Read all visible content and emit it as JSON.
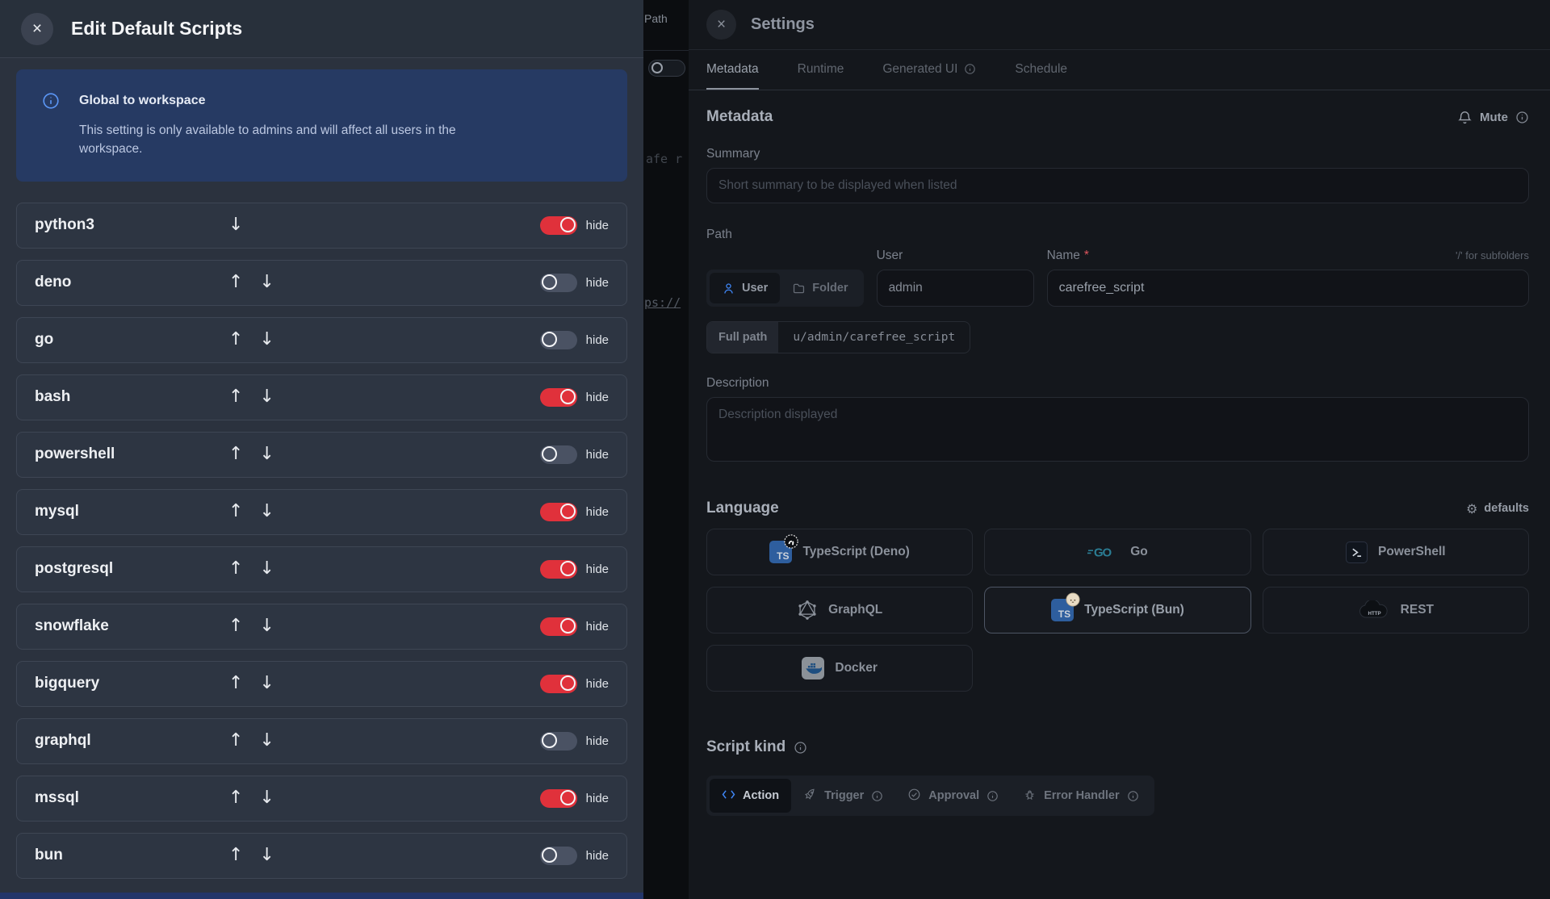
{
  "left_drawer": {
    "title": "Edit Default Scripts",
    "info": {
      "title": "Global to workspace",
      "body": "This setting is only available to admins and will affect all users in the workspace."
    },
    "hide_label": "hide",
    "items": [
      {
        "name": "python3",
        "up": false,
        "down": true,
        "hidden": true
      },
      {
        "name": "deno",
        "up": true,
        "down": true,
        "hidden": false
      },
      {
        "name": "go",
        "up": true,
        "down": true,
        "hidden": false
      },
      {
        "name": "bash",
        "up": true,
        "down": true,
        "hidden": true
      },
      {
        "name": "powershell",
        "up": true,
        "down": true,
        "hidden": false
      },
      {
        "name": "mysql",
        "up": true,
        "down": true,
        "hidden": true
      },
      {
        "name": "postgresql",
        "up": true,
        "down": true,
        "hidden": true
      },
      {
        "name": "snowflake",
        "up": true,
        "down": true,
        "hidden": true
      },
      {
        "name": "bigquery",
        "up": true,
        "down": true,
        "hidden": true
      },
      {
        "name": "graphql",
        "up": true,
        "down": true,
        "hidden": false
      },
      {
        "name": "mssql",
        "up": true,
        "down": true,
        "hidden": true
      },
      {
        "name": "bun",
        "up": true,
        "down": true,
        "hidden": false
      }
    ]
  },
  "background": {
    "path_label": "Path",
    "code_fragment_1": "afe r",
    "code_fragment_2": "ps://"
  },
  "right_drawer": {
    "title": "Settings",
    "tabs": [
      {
        "label": "Metadata",
        "active": true,
        "info": false
      },
      {
        "label": "Runtime",
        "active": false,
        "info": false
      },
      {
        "label": "Generated UI",
        "active": false,
        "info": true
      },
      {
        "label": "Schedule",
        "active": false,
        "info": false
      }
    ],
    "metadata": {
      "heading": "Metadata",
      "mute_label": "Mute",
      "summary_label": "Summary",
      "summary_placeholder": "Short summary to be displayed when listed",
      "path_label": "Path",
      "owner_user_label": "User",
      "owner_folder_label": "Folder",
      "user_label": "User",
      "user_value": "admin",
      "name_label": "Name",
      "name_required_mark": "*",
      "name_hint": "'/' for subfolders",
      "name_value": "carefree_script",
      "full_path_label": "Full path",
      "full_path_value": "u/admin/carefree_script",
      "description_label": "Description",
      "description_placeholder": "Description displayed"
    },
    "language": {
      "heading": "Language",
      "defaults_label": "defaults",
      "options": [
        {
          "label": "TypeScript (Deno)",
          "icon": "ts-deno",
          "selected": false
        },
        {
          "label": "Go",
          "icon": "go",
          "selected": false
        },
        {
          "label": "PowerShell",
          "icon": "pwsh",
          "selected": false
        },
        {
          "label": "GraphQL",
          "icon": "graphql",
          "selected": false
        },
        {
          "label": "TypeScript (Bun)",
          "icon": "ts-bun",
          "selected": true
        },
        {
          "label": "REST",
          "icon": "rest",
          "selected": false
        },
        {
          "label": "Docker",
          "icon": "docker",
          "selected": false
        }
      ]
    },
    "script_kind": {
      "heading": "Script kind",
      "options": [
        {
          "label": "Action",
          "icon": "code",
          "active": true,
          "info": false
        },
        {
          "label": "Trigger",
          "icon": "rocket",
          "active": false,
          "info": true
        },
        {
          "label": "Approval",
          "icon": "check",
          "active": false,
          "info": true
        },
        {
          "label": "Error Handler",
          "icon": "bug",
          "active": false,
          "info": true
        }
      ]
    }
  },
  "icons": {
    "close": "×",
    "up_arrow": "↑",
    "down_arrow": "↓",
    "gear": "⚙",
    "ts_badge": "TS",
    "go_logo": "GO",
    "http_label": "HTTP"
  },
  "colors": {
    "accent_blue": "#3f87f8",
    "toggle_on_red": "#e0313b",
    "info_box_bg": "#263a63"
  }
}
